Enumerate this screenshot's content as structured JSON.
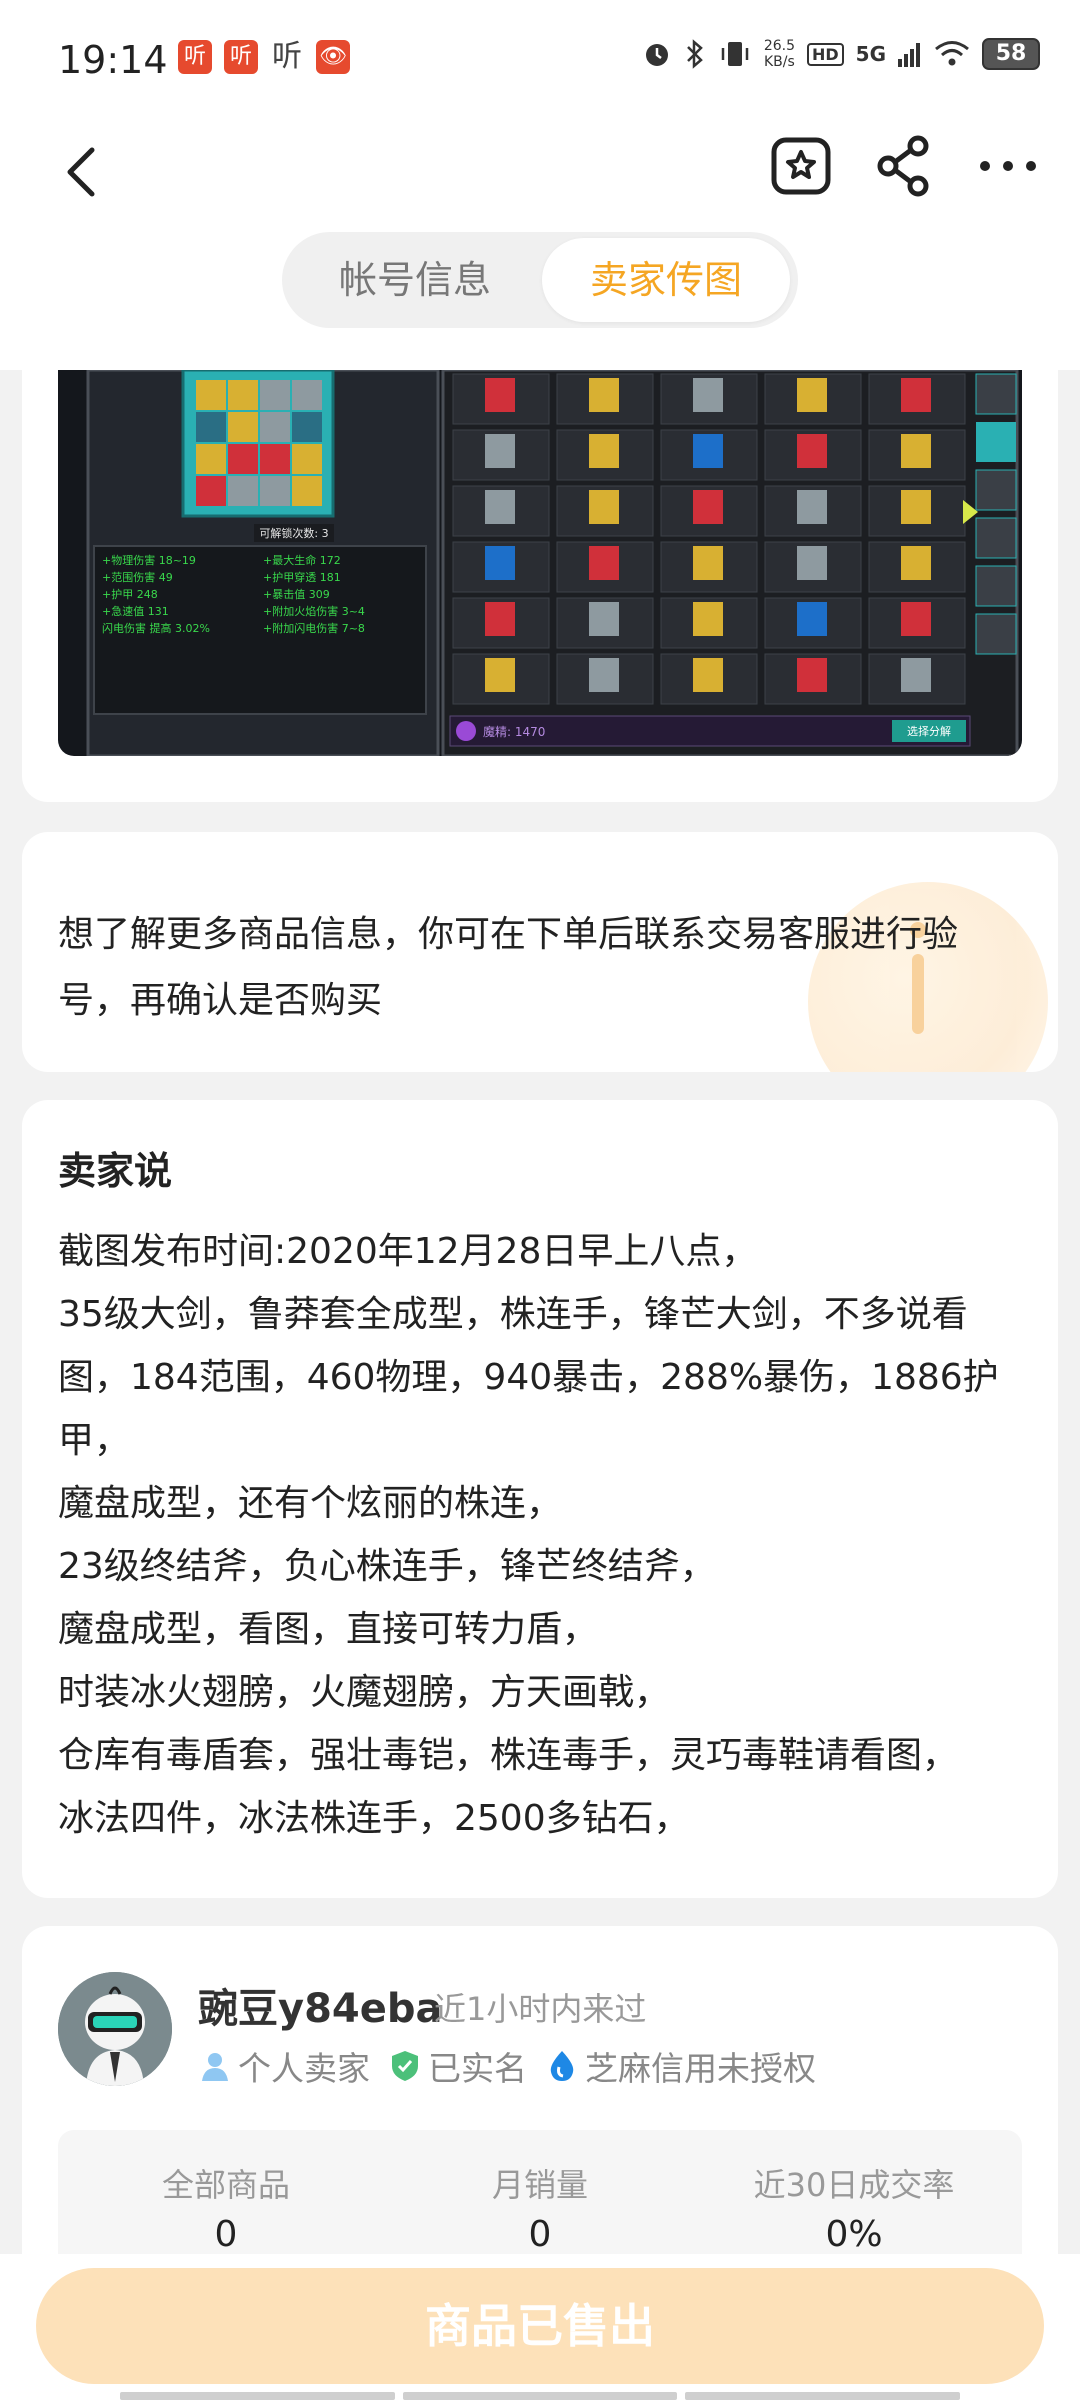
{
  "status_bar": {
    "time": "19:14",
    "app_badges": [
      "听",
      "听",
      "听",
      "👁"
    ],
    "speed_value": "26.5",
    "speed_unit": "KB/s",
    "hd": "HD",
    "network": "5G",
    "battery": "58"
  },
  "header": {
    "icons": [
      "back-arrow-icon",
      "favorite-star-icon",
      "share-icon",
      "more-dots-icon"
    ]
  },
  "tabs": {
    "account_info": "帐号信息",
    "seller_images": "卖家传图"
  },
  "game_screenshot": {
    "unlock_count_label": "可解锁次数: 3",
    "stats_left": [
      "+物理伤害 18~19",
      "+范围伤害 49",
      "+护甲 248",
      "+急速值 131",
      "闪电伤害 提高 3.02%"
    ],
    "stats_right": [
      "+最大生命 172",
      "+护甲穿透 181",
      "+暴击值 309",
      "+附加火焰伤害 3~4",
      "+附加闪电伤害 7~8"
    ],
    "magic_label": "魔精: 1470",
    "decompose_button": "选择分解",
    "colors": {
      "gold": "#d8b032",
      "red": "#d0303a",
      "grey": "#8e9aa0",
      "cyan": "#2ab0b3",
      "blue": "#1d6fc9"
    }
  },
  "notice": {
    "text": "想了解更多商品信息，你可在下单后联系交易客服进行验号，再确认是否购买"
  },
  "seller_says": {
    "title": "卖家说",
    "lines": [
      "截图发布时间:2020年12月28日早上八点，",
      "35级大剑，鲁莽套全成型，株连手，锋芒大剑，不多说看图，184范围，460物理，940暴击，288%暴伤，1886护甲，",
      "魔盘成型，还有个炫丽的株连，",
      "23级终结斧，负心株连手，锋芒终结斧，",
      "魔盘成型，看图，直接可转力盾，",
      "时装冰火翅膀，火魔翅膀，方天画戟，",
      "仓库有毒盾套，强壮毒铠，株连毒手，灵巧毒鞋请看图，",
      "冰法四件，冰法株连手，2500多钻石，"
    ]
  },
  "seller": {
    "name": "豌豆y84eba",
    "active": "近1小时内来过",
    "tags": {
      "personal": "个人卖家",
      "verified": "已实名",
      "credit": "芝麻信用未授权"
    },
    "stats": {
      "all_goods_label": "全部商品",
      "all_goods_value": "0",
      "monthly_sales_label": "月销量",
      "monthly_sales_value": "0",
      "deal_rate_label": "近30日成交率",
      "deal_rate_value": "0%"
    }
  },
  "bottom": {
    "sold_out_label": "商品已售出"
  },
  "accent_color": "#f5a623"
}
